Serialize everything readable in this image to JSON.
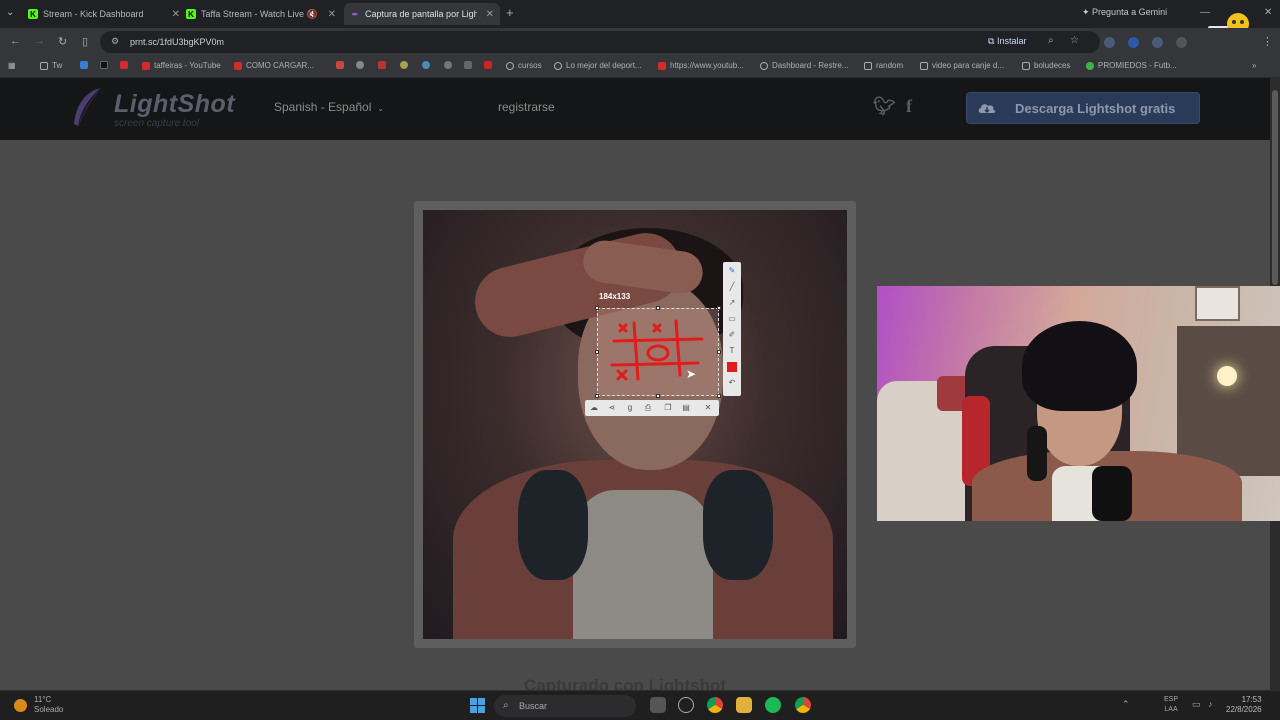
{
  "browser": {
    "tabs": [
      {
        "label": "Stream - Kick Dashboard",
        "icon": "kick-icon",
        "color": "#53fc18"
      },
      {
        "label": "Taffa Stream - Watch Live o",
        "icon": "kick-icon",
        "color": "#53fc18"
      },
      {
        "label": "Captura de pantalla por Lightsh",
        "icon": "lightshot-icon",
        "color": "#8a5fc7"
      }
    ],
    "gemini_label": "Pregunta a Gemini",
    "url": "prnt.sc/1fdU3bgKPV0m",
    "install_label": "Instalar",
    "bookmarks": [
      {
        "label": "Tw",
        "icon": "folder-icon"
      },
      {
        "label": "taffeiras - YouTube",
        "icon": "youtube-icon"
      },
      {
        "label": "COMO CARGAR...",
        "icon": "youtube-icon"
      },
      {
        "label": "cursos",
        "icon": "globe-icon"
      },
      {
        "label": "Lo mejor del deport...",
        "icon": "globe-icon"
      },
      {
        "label": "https://www.youtub...",
        "icon": "youtube-icon"
      },
      {
        "label": "Dashboard - Restre...",
        "icon": "globe-icon"
      },
      {
        "label": "random",
        "icon": "folder-icon"
      },
      {
        "label": "video para canje d...",
        "icon": "folder-icon"
      },
      {
        "label": "boludeces",
        "icon": "folder-icon"
      },
      {
        "label": "PROMIEDOS - Futb...",
        "icon": "promiedos-icon"
      }
    ]
  },
  "site": {
    "logo_text": "LightShot",
    "logo_sub": "screen capture tool",
    "language": "Spanish - Español",
    "register": "registrarse",
    "download_label": "Descarga Lightshot gratis",
    "captured_by": "Capturado con Lightshot",
    "selection_size": "184x133"
  },
  "taskbar": {
    "temperature": "11°C",
    "weather": "Soleado",
    "search_placeholder": "Buscar",
    "lang_top": "ESP",
    "lang_bottom": "LAA",
    "time": "17:53",
    "date": "22/8/2026"
  }
}
